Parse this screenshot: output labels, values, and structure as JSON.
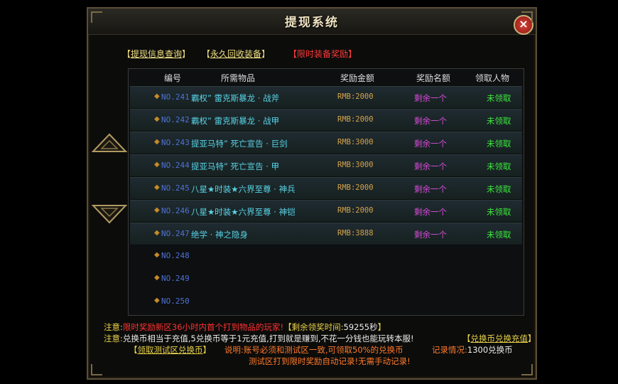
{
  "window": {
    "title": "提现系统",
    "close_icon": "close-icon"
  },
  "tabs": [
    {
      "open": "【",
      "label": "提现信息查询",
      "close": "】",
      "label_color": "#f0e080"
    },
    {
      "open": "【",
      "label": "永久回收装备",
      "close": "】",
      "label_color": "#f0e080"
    },
    {
      "open": "【",
      "label": "限时装备奖励",
      "close": "】",
      "label_color": "#ff3a3a"
    }
  ],
  "table": {
    "headers": {
      "id": "编号",
      "item": "所需物品",
      "amount": "奖励金额",
      "reward": "奖励名额",
      "claimer": "领取人物"
    },
    "rows": [
      {
        "id": "NO.241",
        "item": "霸权” 雷克斯暴龙 · 战斧",
        "amount": "RMB:2000",
        "reward": "剩余一个",
        "claimer": "未领取"
      },
      {
        "id": "NO.242",
        "item": "霸权” 雷克斯暴龙 · 战甲",
        "amount": "RMB:2000",
        "reward": "剩余一个",
        "claimer": "未领取"
      },
      {
        "id": "NO.243",
        "item": "提亚马特” 死亡宣告 · 巨剑",
        "amount": "RMB:3000",
        "reward": "剩余一个",
        "claimer": "未领取"
      },
      {
        "id": "NO.244",
        "item": "提亚马特” 死亡宣告 · 甲",
        "amount": "RMB:3000",
        "reward": "剩余一个",
        "claimer": "未领取"
      },
      {
        "id": "NO.245",
        "item": "八星★时装★六界至尊 · 神兵",
        "amount": "RMB:2000",
        "reward": "剩余一个",
        "claimer": "未领取"
      },
      {
        "id": "NO.246",
        "item": "八星★时装★六界至尊 · 神铠",
        "amount": "RMB:2000",
        "reward": "剩余一个",
        "claimer": "未领取"
      },
      {
        "id": "NO.247",
        "item": "绝学 · 神之隐身",
        "amount": "RMB:3888",
        "reward": "剩余一个",
        "claimer": "未领取"
      },
      {
        "id": "NO.248",
        "item": "",
        "amount": "",
        "reward": "",
        "claimer": ""
      },
      {
        "id": "NO.249",
        "item": "",
        "amount": "",
        "reward": "",
        "claimer": ""
      },
      {
        "id": "NO.250",
        "item": "",
        "amount": "",
        "reward": "",
        "claimer": ""
      }
    ]
  },
  "notes": {
    "line1": {
      "prefix": "注意:",
      "text": "限时奖励新区36小时内首个打到物品的玩家!",
      "timer_label": "【剩余领奖时间:",
      "timer_value": "59255秒",
      "timer_close": "】"
    },
    "line2": {
      "prefix": "注意:",
      "text": "兑换币相当于充值,5兑换币等于1元充值,打到就是赚到,不花一分钱也能玩转本服!",
      "link_open": "【",
      "link": "兑换币兑换充值",
      "link_close": "】"
    },
    "line3": {
      "link_open": "【",
      "link": "领取测试区兑换币",
      "link_close": "】",
      "desc": "说明:账号必须和测试区一致,可领取50%的兑换币",
      "record_label": "记录情况:",
      "record_value": "1300兑换币"
    },
    "line4": {
      "text": "测试区打到限时奖励自动记录!无需手动记录!"
    }
  },
  "arrows": {
    "up": "arrow-up-icon",
    "down": "arrow-down-icon"
  }
}
